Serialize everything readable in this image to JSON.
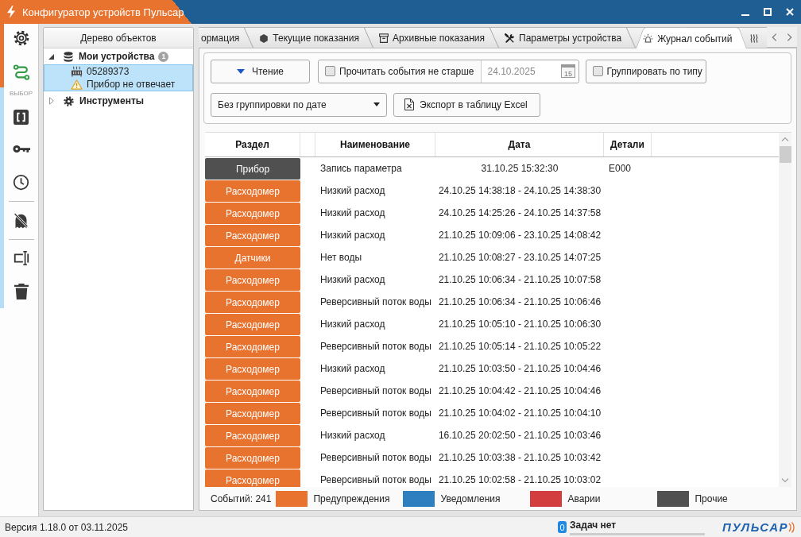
{
  "window": {
    "title": "Конфигуратор устройств Пульсар"
  },
  "sidebar": {
    "section_label": "ВЫБОР"
  },
  "tree": {
    "title": "Дерево объектов",
    "items": [
      {
        "kind": "devices",
        "label": "Мои устройства",
        "badge": "1",
        "expanded": true,
        "selected": false,
        "children": [
          {
            "label": "05289373",
            "status": "Прибор не отвечает",
            "selected": true
          }
        ]
      },
      {
        "kind": "tools",
        "label": "Инструменты",
        "expanded": false,
        "selected": false
      }
    ]
  },
  "tabs": [
    {
      "kind": "info",
      "label": "ормация",
      "selected": false
    },
    {
      "kind": "current",
      "label": "Текущие показания",
      "selected": false
    },
    {
      "kind": "archive",
      "label": "Архивные показания",
      "selected": false
    },
    {
      "kind": "parameters",
      "label": "Параметры устройства",
      "selected": false
    },
    {
      "kind": "journal",
      "label": "Журнал событий",
      "selected": true
    },
    {
      "kind": "heating",
      "selected": false
    }
  ],
  "toolbar": {
    "read_button": {
      "label": "Чтение"
    },
    "date_filter": {
      "label": "Прочитать события не старше",
      "checked": false,
      "date": "24.10.2025",
      "date_disabled": true,
      "calendar_day": "15"
    },
    "group_by_type": {
      "label": "Группировать по типу",
      "checked": false
    },
    "date_grouping": {
      "value": "Без группировки по дате"
    },
    "export_button": {
      "label": "Экспорт в таблицу Excel"
    }
  },
  "table": {
    "columns": [
      "Раздел",
      "Наименование",
      "Дата",
      "Детали"
    ],
    "rows": [
      {
        "section": "Прибор",
        "color": "#505050",
        "name": "Запись параметра",
        "date": "31.10.25 15:32:30",
        "details": "E000"
      },
      {
        "section": "Расходомер",
        "color": "#e8732f",
        "name": "Низкий расход",
        "date": "24.10.25 14:38:18 - 24.10.25 14:38:30"
      },
      {
        "section": "Расходомер",
        "color": "#e8732f",
        "name": "Низкий расход",
        "date": "24.10.25 14:25:26 - 24.10.25 14:37:58"
      },
      {
        "section": "Расходомер",
        "color": "#e8732f",
        "name": "Низкий расход",
        "date": "21.10.25 10:09:06 - 23.10.25 14:08:42"
      },
      {
        "section": "Датчики",
        "color": "#e8732f",
        "name": "Нет воды",
        "date": "21.10.25 10:08:27 - 23.10.25 14:07:25"
      },
      {
        "section": "Расходомер",
        "color": "#e8732f",
        "name": "Низкий расход",
        "date": "21.10.25 10:06:34 - 21.10.25 10:07:58"
      },
      {
        "section": "Расходомер",
        "color": "#e8732f",
        "name": "Реверсивный поток воды",
        "date": "21.10.25 10:06:34 - 21.10.25 10:06:46"
      },
      {
        "section": "Расходомер",
        "color": "#e8732f",
        "name": "Низкий расход",
        "date": "21.10.25 10:05:10 - 21.10.25 10:06:30"
      },
      {
        "section": "Расходомер",
        "color": "#e8732f",
        "name": "Реверсивный поток воды",
        "date": "21.10.25 10:05:14 - 21.10.25 10:05:22"
      },
      {
        "section": "Расходомер",
        "color": "#e8732f",
        "name": "Низкий расход",
        "date": "21.10.25 10:03:50 - 21.10.25 10:04:46"
      },
      {
        "section": "Расходомер",
        "color": "#e8732f",
        "name": "Реверсивный поток воды",
        "date": "21.10.25 10:04:42 - 21.10.25 10:04:46"
      },
      {
        "section": "Расходомер",
        "color": "#e8732f",
        "name": "Реверсивный поток воды",
        "date": "21.10.25 10:04:02 - 21.10.25 10:04:10"
      },
      {
        "section": "Расходомер",
        "color": "#e8732f",
        "name": "Низкий расход",
        "date": "16.10.25 20:02:50 - 21.10.25 10:03:46"
      },
      {
        "section": "Расходомер",
        "color": "#e8732f",
        "name": "Реверсивный поток воды",
        "date": "21.10.25 10:03:38 - 21.10.25 10:03:42"
      },
      {
        "section": "Расходомер",
        "color": "#e8732f",
        "name": "Реверсивный поток воды",
        "date": "21.10.25 10:02:58 - 21.10.25 10:03:02"
      }
    ]
  },
  "legend": {
    "count": "Событий: 241",
    "items": [
      {
        "label": "Предупреждения",
        "color": "#e8732f"
      },
      {
        "label": "Уведомления",
        "color": "#2e7fc0"
      },
      {
        "label": "Аварии",
        "color": "#d43d3d"
      },
      {
        "label": "Прочие",
        "color": "#505050"
      }
    ]
  },
  "status_bar": {
    "version": "Версия 1.18.0 от 03.11.2025",
    "tasks": {
      "count": "0",
      "label": "Задач нет"
    },
    "logo": "ПУЛЬСАР"
  }
}
